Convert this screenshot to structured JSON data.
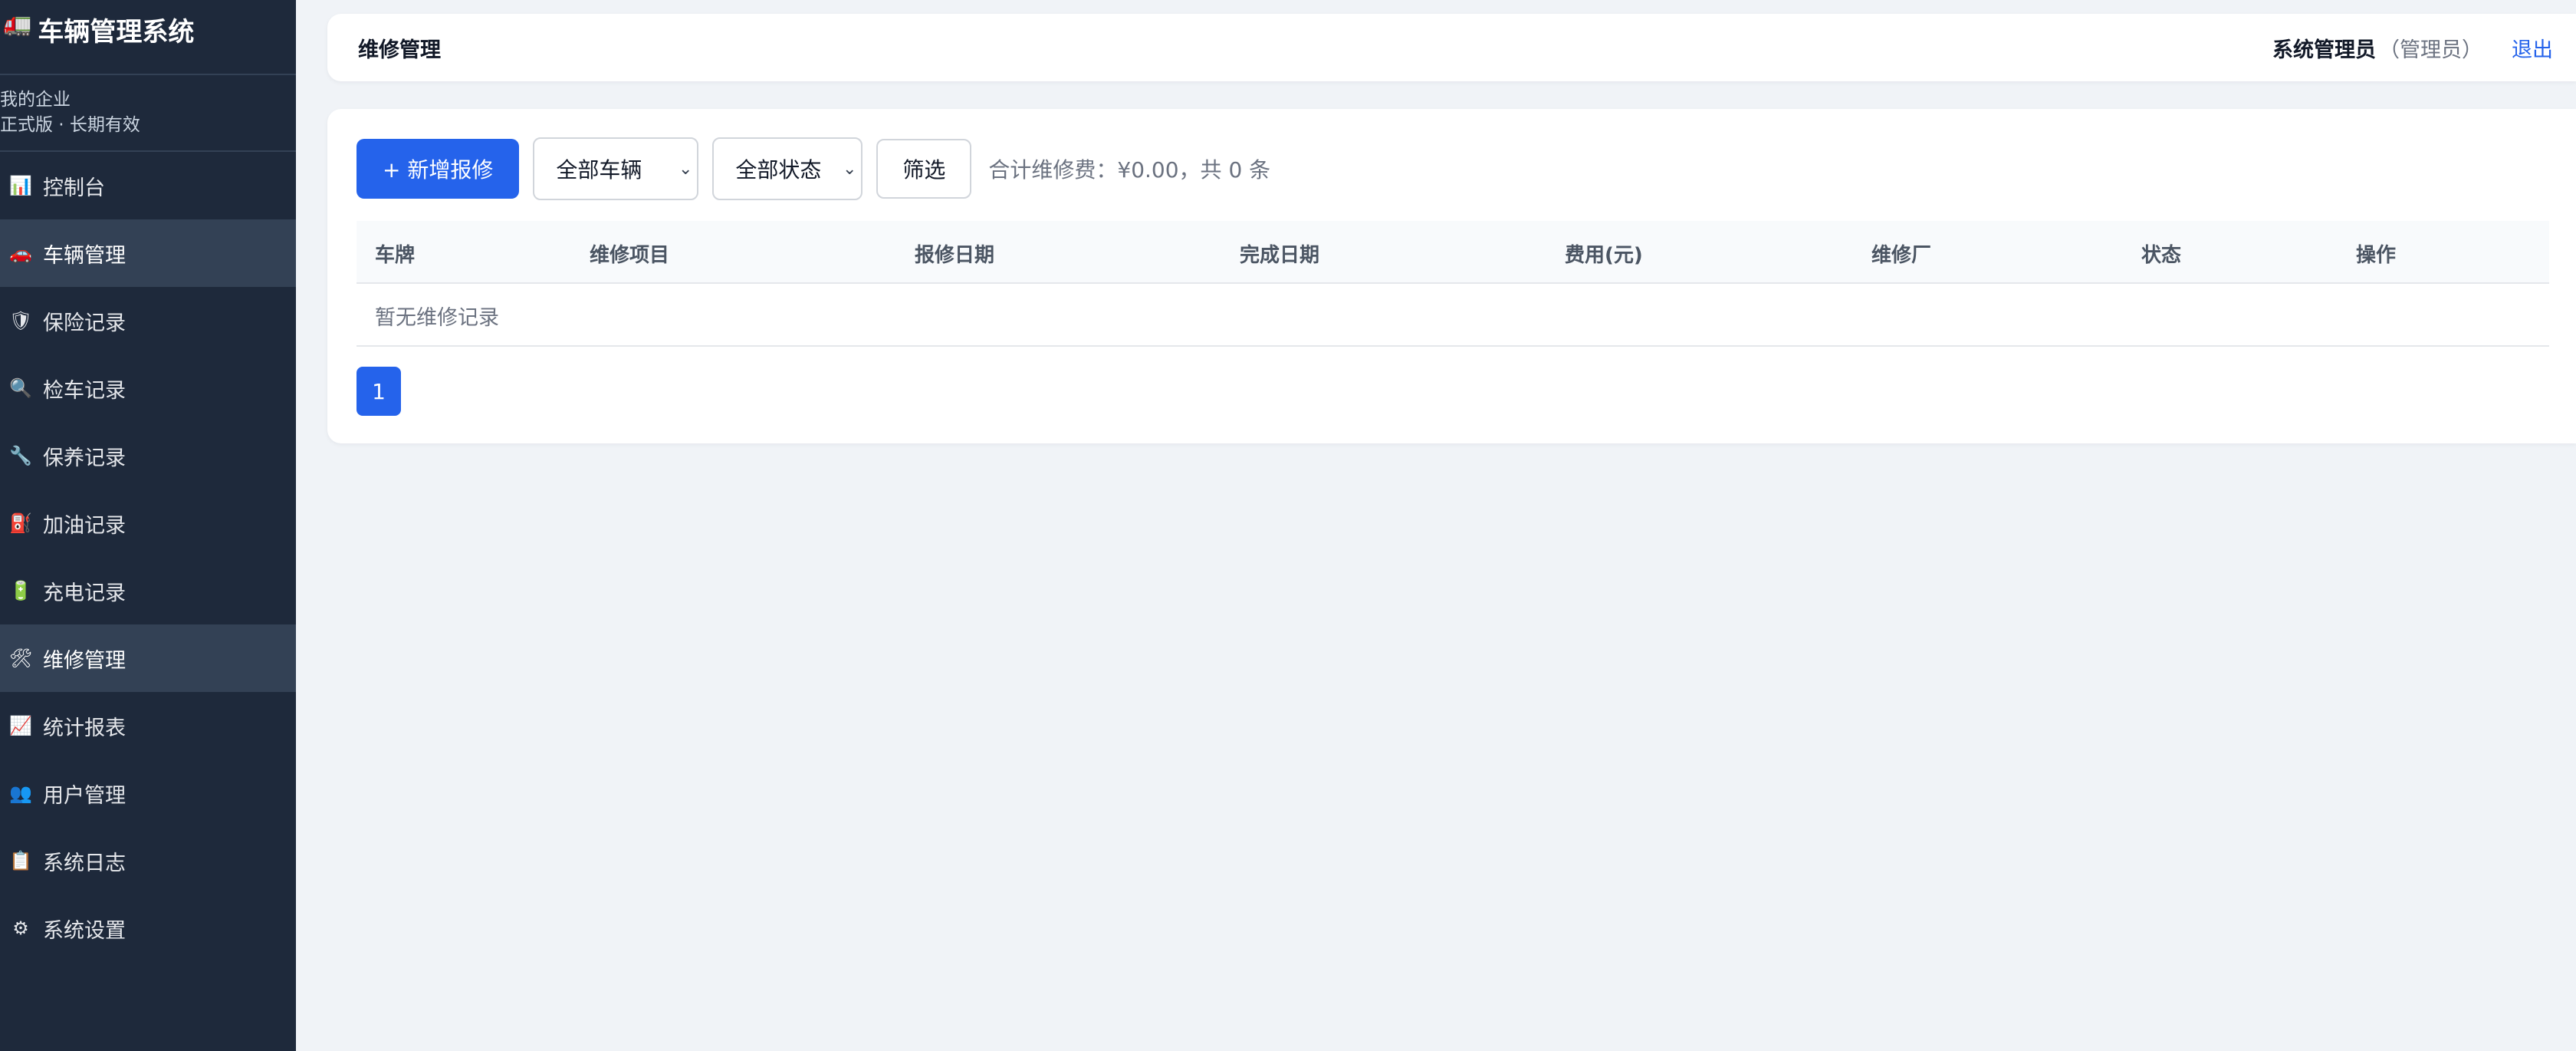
{
  "app": {
    "title": "车辆管理系统",
    "logo_icon": "truck-icon"
  },
  "company": {
    "name": "我的企业",
    "plan": "正式版 · 长期有效"
  },
  "sidebar": {
    "items": [
      {
        "label": "控制台",
        "icon": "📊"
      },
      {
        "label": "车辆管理",
        "icon": "🚗"
      },
      {
        "label": "保险记录",
        "icon": "🛡"
      },
      {
        "label": "检车记录",
        "icon": "🔍"
      },
      {
        "label": "保养记录",
        "icon": "🔧"
      },
      {
        "label": "加油记录",
        "icon": "⛽"
      },
      {
        "label": "充电记录",
        "icon": "🔋"
      },
      {
        "label": "维修管理",
        "icon": "🛠"
      },
      {
        "label": "统计报表",
        "icon": "📈"
      },
      {
        "label": "用户管理",
        "icon": "👥"
      },
      {
        "label": "系统日志",
        "icon": "📋"
      },
      {
        "label": "系统设置",
        "icon": "⚙"
      }
    ]
  },
  "header": {
    "page_title": "维修管理",
    "user_name": "系统管理员",
    "user_role": "（管理员）",
    "logout": "退出"
  },
  "toolbar": {
    "add_label": "+ 新增报修",
    "vehicle_select": "全部车辆",
    "status_select": "全部状态",
    "filter_label": "筛选",
    "summary": "合计维修费：¥0.00，共 0 条"
  },
  "table": {
    "columns": [
      "车牌",
      "维修项目",
      "报修日期",
      "完成日期",
      "费用(元)",
      "维修厂",
      "状态",
      "操作"
    ],
    "empty_text": "暂无维修记录"
  },
  "pagination": {
    "current": "1"
  },
  "colors": {
    "sidebar_bg": "#1e293b",
    "primary": "#2563eb",
    "page_bg": "#f0f3f7"
  }
}
